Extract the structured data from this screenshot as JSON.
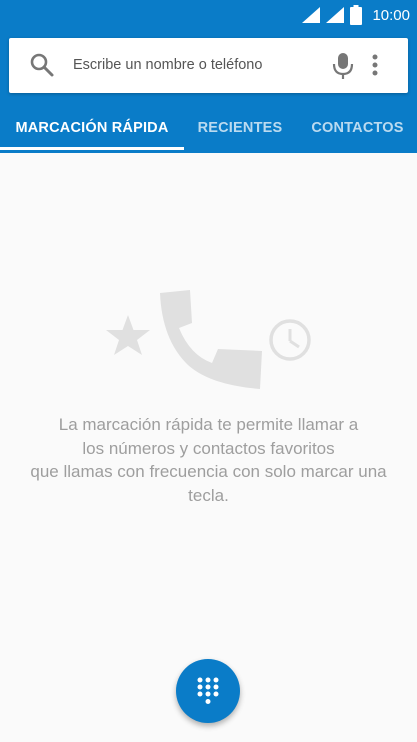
{
  "status_bar": {
    "time": "10:00",
    "icons": [
      "wifi-icon",
      "signal-icon",
      "battery-icon"
    ]
  },
  "search": {
    "placeholder": "Escribe un nombre o teléfono",
    "value": "",
    "icons": [
      "search-icon",
      "mic-icon",
      "more-vert-icon"
    ]
  },
  "tabs": [
    {
      "label": "MARCACIÓN RÁPIDA",
      "active": true
    },
    {
      "label": "RECIENTES",
      "active": false
    },
    {
      "label": "CONTACTOS",
      "active": false
    }
  ],
  "empty_state": {
    "icons": [
      "star-icon",
      "phone-icon",
      "clock-icon"
    ],
    "lines": [
      "La marcación rápida te permite llamar a",
      "los números y contactos favoritos",
      "que llamas con frecuencia con solo marcar una",
      "tecla."
    ]
  },
  "fab": {
    "icon": "dialpad-icon"
  },
  "colors": {
    "primary": "#0a7cc8",
    "background": "#fafafa",
    "empty_text": "#9e9e9e",
    "illustration": "#e0e0e0"
  }
}
